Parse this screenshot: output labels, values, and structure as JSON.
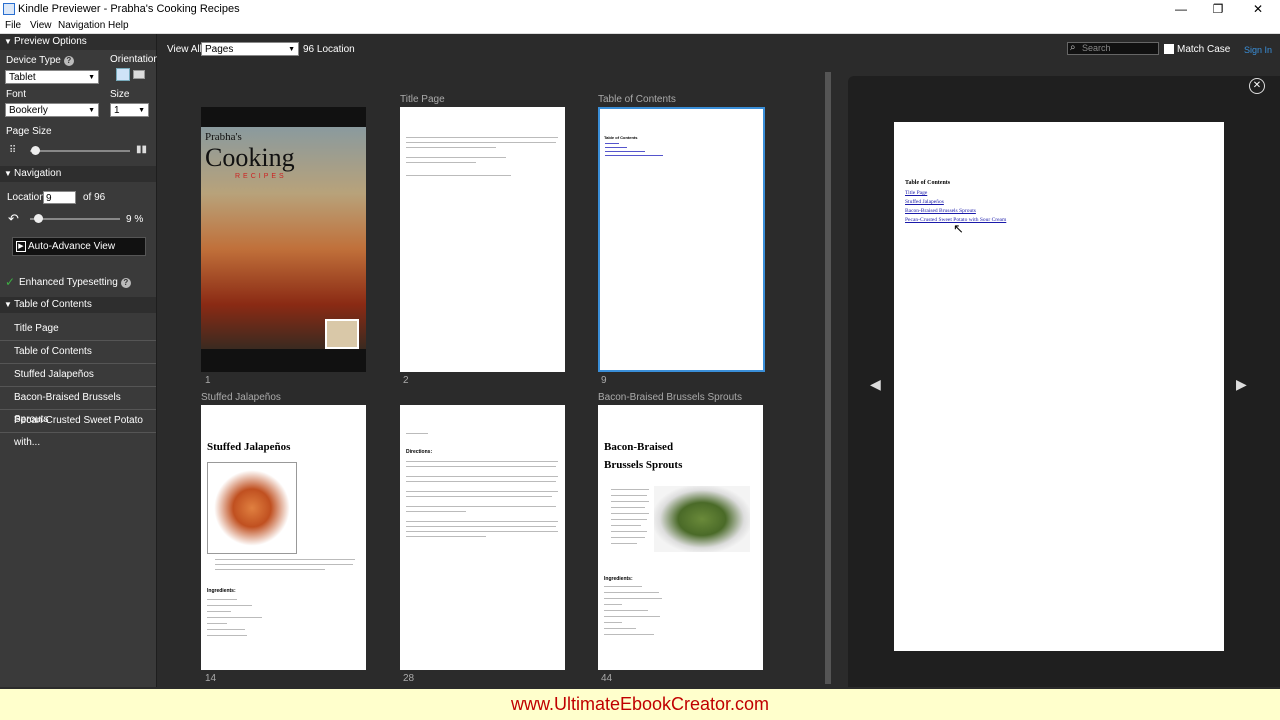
{
  "window": {
    "title": "Kindle Previewer - Prabha's Cooking Recipes",
    "minimize": "—",
    "maximize": "❐",
    "close": "✕"
  },
  "menu": {
    "items": [
      "File",
      "View",
      "Navigation",
      "Help"
    ]
  },
  "left": {
    "preview_options": "Preview Options",
    "device_type_label": "Device Type",
    "orientation_label": "Orientation",
    "device_type_value": "Tablet",
    "font_label": "Font",
    "size_label": "Size",
    "font_value": "Bookerly",
    "size_value": "1",
    "page_size_label": "Page Size",
    "navigation": "Navigation",
    "location_label": "Location",
    "location_value": "9",
    "location_of": "of 96",
    "progress": {
      "percent_text": "9 %",
      "value": 0.09
    },
    "auto_advance": "Auto-Advance View",
    "enhanced_typesetting": "Enhanced Typesetting",
    "toc_header": "Table of Contents",
    "toc_items": [
      "Title Page",
      "Table of Contents",
      "Stuffed Jalapeños",
      "Bacon-Braised Brussels Sprouts",
      "Pecan-Crusted Sweet Potato with..."
    ]
  },
  "toolbar": {
    "view_all": "View All",
    "view_mode": "Pages",
    "location_count": "96 Location",
    "search_placeholder": "Search",
    "match_case": "Match Case",
    "sign_in": "Sign In"
  },
  "grid": {
    "pages": [
      {
        "label": "",
        "num": "1",
        "cover_title1": "Prabha's",
        "cover_title2": "Cooking",
        "cover_title3": "RECIPES"
      },
      {
        "label": "Title Page",
        "num": "2"
      },
      {
        "label": "Table of Contents",
        "num": "9",
        "mini_toc_title": "Table of Contents"
      },
      {
        "label": "Stuffed Jalapeños",
        "num": "14",
        "heading": "Stuffed Jalapeños",
        "sub": "Ingredients:"
      },
      {
        "label": "",
        "num": "28",
        "heading": "Directions:"
      },
      {
        "label": "Bacon-Braised Brussels Sprouts",
        "num": "44",
        "heading1": "Bacon-Braised",
        "heading2": "Brussels Sprouts",
        "sub": "Ingredients:"
      }
    ]
  },
  "preview": {
    "toc_title": "Table of Contents",
    "links": [
      "Title Page",
      "Stuffed Jalapeños",
      "Bacon-Braised Brussels Sprouts",
      "Pecan-Crusted Sweet Potato with Sour Cream"
    ]
  },
  "footer": {
    "text": "www.UltimateEbookCreator.com",
    "color": "#c00000"
  }
}
